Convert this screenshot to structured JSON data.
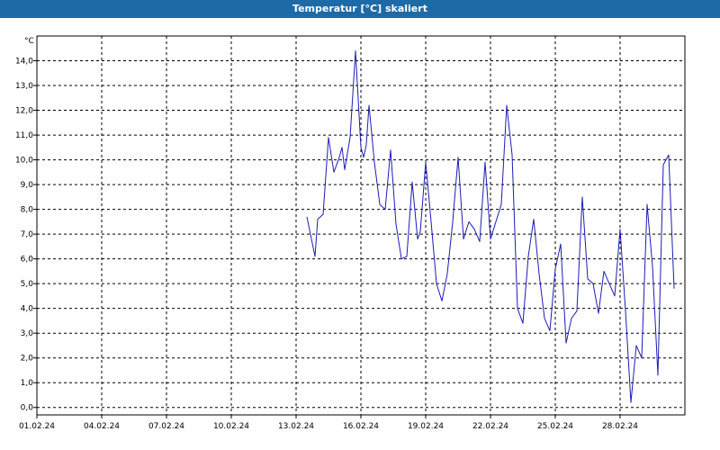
{
  "window": {
    "title": "Temperatur [°C] skaliert"
  },
  "colors": {
    "titlebar": "#1d6aa6",
    "line": "#1c1cb4",
    "grid": "#000000"
  },
  "chart_data": {
    "type": "line",
    "title": "Temperatur [°C] skaliert",
    "ylabel": "°C",
    "xlabel": "",
    "grid": true,
    "ylim": [
      -0.3,
      15.0
    ],
    "xlim": [
      "2024-02-01",
      "2024-03-02"
    ],
    "yticks": [
      "0,0",
      "1,0",
      "2,0",
      "3,0",
      "4,0",
      "5,0",
      "6,0",
      "7,0",
      "8,0",
      "9,0",
      "10,0",
      "11,0",
      "12,0",
      "13,0",
      "14,0"
    ],
    "xticks": [
      "01.02.24",
      "04.02.24",
      "07.02.24",
      "10.02.24",
      "13.02.24",
      "16.02.24",
      "19.02.24",
      "22.02.24",
      "25.02.24",
      "28.02.24"
    ],
    "series": [
      {
        "x": [
          "2024-02-13T12:00",
          "2024-02-13T21:00",
          "2024-02-14T00:00",
          "2024-02-14T06:00",
          "2024-02-14T12:00",
          "2024-02-14T18:00",
          "2024-02-15T00:00",
          "2024-02-15T03:00",
          "2024-02-15T06:00",
          "2024-02-15T12:00",
          "2024-02-15T18:00",
          "2024-02-16T00:00",
          "2024-02-16T03:00",
          "2024-02-16T06:00",
          "2024-02-16T09:00",
          "2024-02-16T15:00",
          "2024-02-16T21:00",
          "2024-02-17T03:00",
          "2024-02-17T09:00",
          "2024-02-17T15:00",
          "2024-02-17T21:00",
          "2024-02-18T03:00",
          "2024-02-18T09:00",
          "2024-02-18T15:00",
          "2024-02-18T18:00",
          "2024-02-19T00:00",
          "2024-02-19T06:00",
          "2024-02-19T12:00",
          "2024-02-19T18:00",
          "2024-02-20T00:00",
          "2024-02-20T06:00",
          "2024-02-20T12:00",
          "2024-02-20T18:00",
          "2024-02-21T00:00",
          "2024-02-21T06:00",
          "2024-02-21T12:00",
          "2024-02-21T18:00",
          "2024-02-22T00:00",
          "2024-02-22T06:00",
          "2024-02-22T12:00",
          "2024-02-22T18:00",
          "2024-02-23T00:00",
          "2024-02-23T06:00",
          "2024-02-23T12:00",
          "2024-02-23T18:00",
          "2024-02-24T00:00",
          "2024-02-24T06:00",
          "2024-02-24T12:00",
          "2024-02-24T18:00",
          "2024-02-25T00:00",
          "2024-02-25T06:00",
          "2024-02-25T12:00",
          "2024-02-25T18:00",
          "2024-02-26T00:00",
          "2024-02-26T06:00",
          "2024-02-26T12:00",
          "2024-02-26T18:00",
          "2024-02-27T00:00",
          "2024-02-27T06:00",
          "2024-02-27T12:00",
          "2024-02-27T18:00",
          "2024-02-28T00:00",
          "2024-02-28T06:00",
          "2024-02-28T12:00",
          "2024-02-28T18:00",
          "2024-02-29T00:00",
          "2024-02-29T06:00",
          "2024-02-29T12:00",
          "2024-02-29T18:00",
          "2024-03-01T00:00",
          "2024-03-01T06:00",
          "2024-03-01T12:00"
        ],
        "values": [
          7.7,
          6.1,
          7.6,
          7.8,
          10.9,
          9.5,
          10.1,
          10.5,
          9.6,
          10.9,
          14.4,
          10.5,
          10.1,
          10.6,
          12.2,
          9.9,
          8.2,
          8.0,
          10.4,
          7.4,
          6.0,
          6.1,
          9.1,
          6.8,
          7.1,
          9.9,
          7.5,
          5.0,
          4.3,
          5.4,
          7.5,
          10.1,
          6.8,
          7.5,
          7.2,
          6.7,
          9.9,
          6.8,
          7.5,
          8.2,
          12.2,
          10.2,
          4.0,
          3.4,
          6.1,
          7.6,
          5.4,
          3.6,
          3.1,
          5.6,
          6.6,
          2.6,
          3.6,
          3.9,
          8.5,
          5.2,
          5.0,
          3.8,
          5.5,
          5.0,
          4.5,
          7.2,
          3.9,
          0.2,
          2.5,
          2.0,
          8.2,
          5.7,
          1.3,
          9.8,
          10.2,
          4.8
        ]
      }
    ]
  }
}
